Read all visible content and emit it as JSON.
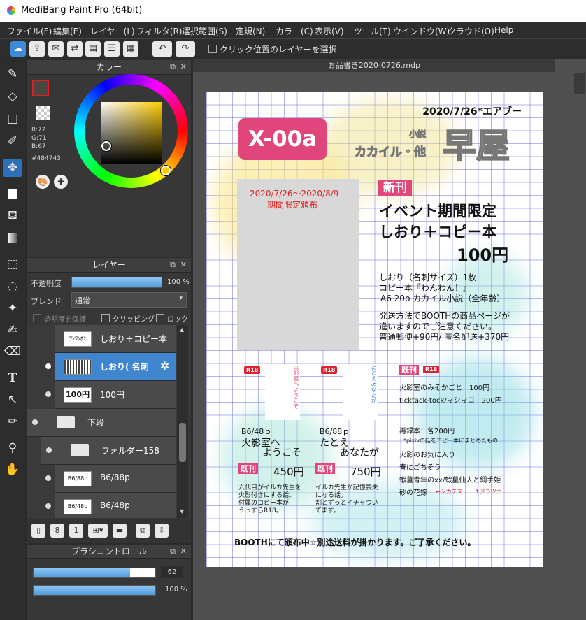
{
  "window": {
    "title": "MediBang Paint Pro (64bit)"
  },
  "menu": [
    "ファイル(F)",
    "編集(E)",
    "レイヤー(L)",
    "フィルタ(R)",
    "選択範囲(S)",
    "定規(N)",
    "カラー(C)",
    "表示(V)",
    "ツール(T)",
    "ウインドウ(W)",
    "クラウド(O)",
    "Help"
  ],
  "toolbar": {
    "select_layer_label": "クリック位置のレイヤーを選択",
    "buttons": [
      "cloud-sync-icon",
      "upload-icon",
      "comment-icon",
      "share-icon",
      "page-icon",
      "page-list-icon",
      "grid-icon",
      "undo-icon",
      "redo-icon"
    ]
  },
  "color_panel": {
    "title": "カラー",
    "r": "R:72",
    "g": "G:71",
    "b": "B:67",
    "hex": "#484743",
    "fg": "#484743",
    "accent": "#3f86cf"
  },
  "layer_panel": {
    "title": "レイヤー",
    "opacity_label": "不透明度",
    "opacity_value": "100 %",
    "opacity": 100,
    "blend_label": "ブレンド",
    "blend_value": "通常",
    "protect_alpha": "透明度を保護",
    "clipping": "クリッピング",
    "lock": "ロック",
    "layers": [
      {
        "name": "しおり＋コピー本",
        "thumb": "ﾜﾝﾜﾝﾎﾝ"
      },
      {
        "name": "しおり( 名刺",
        "thumb": "",
        "selected": true
      },
      {
        "name": "100円",
        "thumb": "100円"
      },
      {
        "name": "下段",
        "type": "folder"
      },
      {
        "name": "フォルダー158",
        "type": "folder"
      },
      {
        "name": "B6/88p",
        "thumb": "B6/88p"
      },
      {
        "name": "B6/48p",
        "thumb": "B6/48p"
      }
    ]
  },
  "brush_panel": {
    "title": "ブラシコントロール",
    "size_value": "62",
    "size": 62,
    "opacity_value": "100 %",
    "opacity": 100
  },
  "document": {
    "tab": "お品書き2020-0726.mdp"
  },
  "flyer": {
    "date_event": "2020/7/26*エアブー",
    "space_code": "X-00a",
    "circle_small_1": "小説",
    "circle_small_2": "カカイル・他",
    "circle_name": "早屋",
    "period_line1": "2020/7/26～2020/8/9",
    "period_line2": "期間限定頒布",
    "new_badge": "新刊",
    "headline1": "イベント期間限定",
    "headline2": "しおり＋コピー本",
    "headline_price": "100円",
    "detail1": "しおり（名刺サイズ）1枚",
    "detail2": "コピー本『わんわん！』",
    "detail3": "A6 20p カカイル小説（全年齢）",
    "ship1": "発送方法でBOOTHの商品ページが",
    "ship2": "違いますのでご注意ください。",
    "ship3": "普通郵便+90円/ 匿名配送+370円",
    "r18": "R18",
    "book1": {
      "spec": "B6/48ｐ",
      "title1": "火影室へ",
      "title2": "ようこそ",
      "badge": "既刊",
      "price": "450円",
      "desc1": "六代目がイルカ先生を",
      "desc2": "火影付きにする話。",
      "desc3": "付属のコピー本が",
      "desc4": "うっすらR18。"
    },
    "book2": {
      "spec": "B6/88ｐ",
      "title1": "たとえ",
      "title2": "あなたが",
      "badge": "既刊",
      "price": "750円",
      "desc1": "イルカ先生が記憶喪失",
      "desc2": "になる話。",
      "desc3": "割とずっとイチャつい",
      "desc4": "てます。"
    },
    "old": {
      "badge": "既刊",
      "r18": "R18",
      "item1": "火影室のみそかごと　100円",
      "item2": "ticktack-tock/マシマロ　200円",
      "reprint": "再録本：各200円",
      "reprint_note": "*pixivの話をコピー本にまとめたもの",
      "list1": "火影のお気に入り",
      "list2": "春にごちそう",
      "list3": "蝦蟇青年のxx/蝦蟇仙人と綱手姫",
      "list4": "砂の花嫁",
      "note1": "←シカテマ",
      "note2": "↑ジラツナ"
    },
    "footer": "BOOTHにて頒布中☆別途送料が掛かります。ご了承ください。",
    "cover1_text": "火影室へようこそ",
    "cover2_text": "たとえあなたが"
  }
}
